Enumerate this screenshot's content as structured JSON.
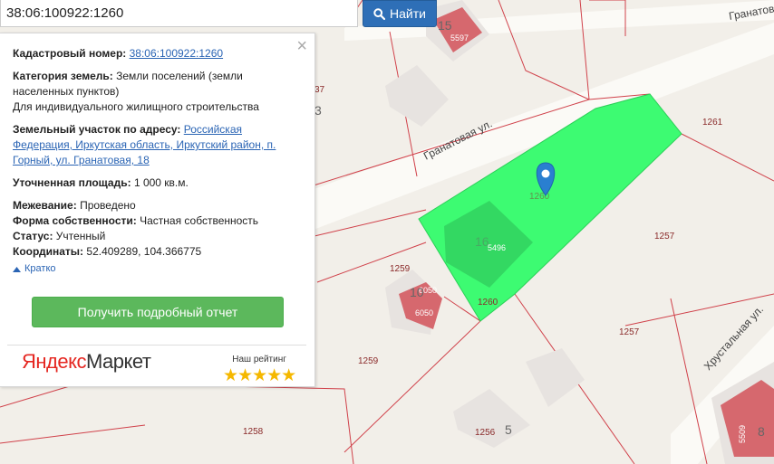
{
  "search": {
    "value": "38:06:100922:1260",
    "button_label": "Найти",
    "button_icon": "search-icon"
  },
  "panel": {
    "close_label": "×",
    "cadastral_label": "Кадастровый номер:",
    "cadastral_value": "38:06:100922:1260",
    "category_label": "Категория земель:",
    "category_value": "Земли поселений (земли населенных пунктов)",
    "use_value": "Для индивидуального жилищного строительства",
    "address_label": "Земельный участок по адресу:",
    "address_value": "Российская Федерация, Иркутская область, Иркутский район, п. Горный, ул. Гранатовая, 18",
    "area_label": "Уточненная площадь:",
    "area_value": "1 000 кв.м.",
    "survey_label": "Межевание:",
    "survey_value": "Проведено",
    "ownership_label": "Форма собственности:",
    "ownership_value": "Частная собственность",
    "status_label": "Статус:",
    "status_value": "Учтенный",
    "coords_label": "Координаты:",
    "coords_value": "52.409289, 104.366775",
    "collapse_label": "Кратко",
    "report_button": "Получить подробный отчет",
    "ym_logo_1": "Яндекс",
    "ym_logo_2": "Маркет",
    "rating_label": "Наш рейтинг",
    "rating_stars": "★★★★★",
    "rating_value": 5
  },
  "map": {
    "streets": {
      "granatovaya": "Гранатовая ул.",
      "granatovaya_top": "Гранатов",
      "khrustalnaya": "Хрустальная ул."
    },
    "parcel_labels": {
      "p1261": "1261",
      "p1257a": "1257",
      "p1257b": "1257",
      "p1259a": "1259",
      "p1259b": "1259",
      "p1260": "1260",
      "p1260b": "1260",
      "p1258": "1258",
      "p1256": "1256",
      "p137": "37"
    },
    "building_labels": {
      "b5597": "5597",
      "b6050a": "6050",
      "b6050b": "6050",
      "b5496": "5496",
      "b5509": "5509"
    },
    "house_numbers": {
      "h15": "15",
      "h3": "3",
      "h10": "10",
      "h5": "5",
      "h8": "8",
      "h16": "16"
    },
    "highlight_color": "#3dfb72",
    "marker_color": "#2a7fd0"
  }
}
